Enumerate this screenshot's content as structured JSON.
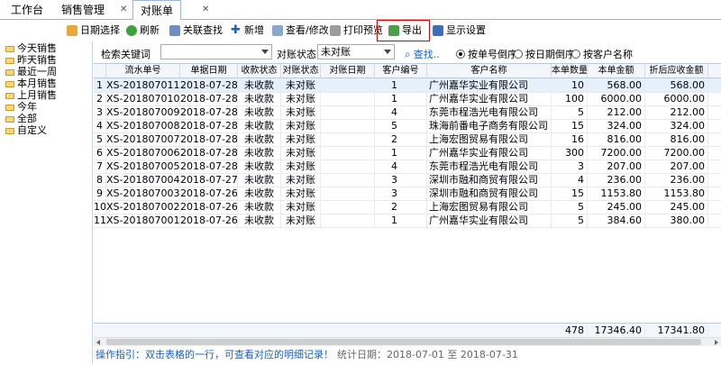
{
  "tabs": [
    {
      "label": "工作台"
    },
    {
      "label": "销售管理"
    },
    {
      "label": "对账单"
    }
  ],
  "toolbar": {
    "date_select": "日期选择",
    "refresh": "刷新",
    "related_search": "关联查找",
    "add": "新增",
    "view_edit": "查看/修改",
    "print_preview": "打印预览",
    "export": "导出",
    "display_settings": "显示设置"
  },
  "tree": [
    "今天销售",
    "昨天销售",
    "最近一周",
    "本月销售",
    "上月销售",
    "今年",
    "全部",
    "自定义"
  ],
  "filter": {
    "keyword_label": "检索关键词",
    "keyword_value": "",
    "status_label": "对账状态",
    "status_value": "未对账",
    "search": "查找..",
    "sort_options": [
      "按单号倒序",
      "按日期倒序",
      "按客户名称"
    ],
    "sort_selected": 0
  },
  "grid": {
    "columns": [
      "",
      "流水单号",
      "单据日期",
      "收款状态",
      "对账状态",
      "对账日期",
      "客户编号",
      "客户名称",
      "本单数量",
      "本单金额",
      "折后应收金额"
    ],
    "rows": [
      [
        "1",
        "XS-201807011",
        "2018-07-28",
        "未收款",
        "未对账",
        "",
        "1",
        "广州嘉华实业有限公司",
        "10",
        "568.00",
        "568.00"
      ],
      [
        "2",
        "XS-201807010",
        "2018-07-28",
        "未收款",
        "未对账",
        "",
        "1",
        "广州嘉华实业有限公司",
        "100",
        "6000.00",
        "6000.00"
      ],
      [
        "3",
        "XS-201807009",
        "2018-07-28",
        "未收款",
        "未对账",
        "",
        "4",
        "东莞市程浩光电有限公司",
        "5",
        "212.00",
        "212.00"
      ],
      [
        "4",
        "XS-201807008",
        "2018-07-28",
        "未收款",
        "未对账",
        "",
        "5",
        "珠海前番电子商务有限公司",
        "15",
        "324.00",
        "324.00"
      ],
      [
        "5",
        "XS-201807007",
        "2018-07-28",
        "未收款",
        "未对账",
        "",
        "2",
        "上海宏图贸易有限公司",
        "16",
        "816.00",
        "816.00"
      ],
      [
        "6",
        "XS-201807006",
        "2018-07-28",
        "未收款",
        "未对账",
        "",
        "1",
        "广州嘉华实业有限公司",
        "300",
        "7200.00",
        "7200.00"
      ],
      [
        "7",
        "XS-201807005",
        "2018-07-28",
        "未收款",
        "未对账",
        "",
        "4",
        "东莞市程浩光电有限公司",
        "3",
        "207.00",
        "207.00"
      ],
      [
        "8",
        "XS-201807004",
        "2018-07-27",
        "未收款",
        "未对账",
        "",
        "3",
        "深圳市融和商贸有限公司",
        "4",
        "236.00",
        "236.00"
      ],
      [
        "9",
        "XS-201807003",
        "2018-07-26",
        "未收款",
        "未对账",
        "",
        "3",
        "深圳市融和商贸有限公司",
        "15",
        "1153.80",
        "1153.80"
      ],
      [
        "10",
        "XS-201807002",
        "2018-07-26",
        "未收款",
        "未对账",
        "",
        "2",
        "上海宏图贸易有限公司",
        "5",
        "245.00",
        "245.00"
      ],
      [
        "11",
        "XS-201807001",
        "2018-07-26",
        "未收款",
        "未对账",
        "",
        "1",
        "广州嘉华实业有限公司",
        "5",
        "384.60",
        "380.00"
      ]
    ],
    "totals": {
      "qty": "478",
      "amount": "17346.40",
      "net": "17341.80"
    }
  },
  "status": {
    "hint": "操作指引：双击表格的一行，可查看对应的明细记录！",
    "stat": "统计日期：2018-07-01 至 2018-07-31"
  },
  "colors": {
    "accent": "#1a5fc4",
    "export_highlight": "#e00000"
  }
}
